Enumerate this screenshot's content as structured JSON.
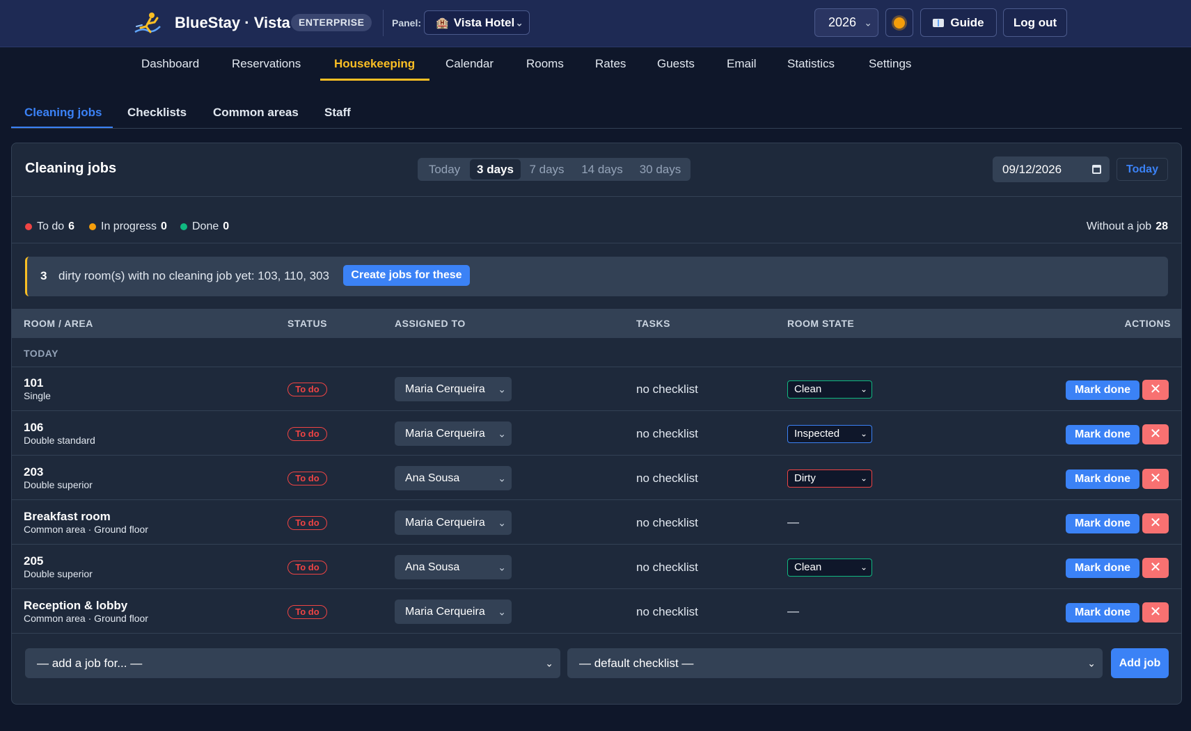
{
  "header": {
    "brand": "BlueStay · Vista",
    "badge": "ENTERPRISE",
    "panel_label": "Panel:",
    "panel_value": "Vista Hotel",
    "year": "2026",
    "guide_label": "Guide",
    "logout_label": "Log out"
  },
  "nav": {
    "items": [
      "Dashboard",
      "Reservations",
      "Housekeeping",
      "Calendar",
      "Rooms",
      "Rates",
      "Guests",
      "Email",
      "Statistics",
      "Settings"
    ],
    "active": "Housekeeping"
  },
  "subtabs": {
    "items": [
      "Cleaning jobs",
      "Checklists",
      "Common areas",
      "Staff"
    ],
    "active": "Cleaning jobs"
  },
  "card": {
    "title": "Cleaning jobs",
    "ranges": [
      "Today",
      "3 days",
      "7 days",
      "14 days",
      "30 days"
    ],
    "active_range": "3 days",
    "date": "09/12/2026",
    "today_label": "Today"
  },
  "stats": {
    "todo_label": "To do",
    "todo_count": "6",
    "inprogress_label": "In progress",
    "inprogress_count": "0",
    "done_label": "Done",
    "done_count": "0",
    "without_label": "Without a job",
    "without_count": "28",
    "colors": {
      "todo": "#ef4444",
      "inprogress": "#f59e0b",
      "done": "#10b981"
    }
  },
  "alert": {
    "count": "3",
    "text": "dirty room(s) with no cleaning job yet: 103, 110, 303",
    "button": "Create jobs for these"
  },
  "table": {
    "headers": {
      "room": "ROOM / AREA",
      "status": "STATUS",
      "assigned": "ASSIGNED TO",
      "tasks": "TASKS",
      "state": "ROOM STATE",
      "actions": "ACTIONS"
    },
    "group": "TODAY",
    "mark_label": "Mark done",
    "delete_label": "✕",
    "rows": [
      {
        "name": "101",
        "sub": "Single",
        "status": "To do",
        "assignee": "Maria Cerqueira",
        "tasks": "no checklist",
        "state": "Clean",
        "state_color": "#10b981"
      },
      {
        "name": "106",
        "sub": "Double standard",
        "status": "To do",
        "assignee": "Maria Cerqueira",
        "tasks": "no checklist",
        "state": "Inspected",
        "state_color": "#3b82f6"
      },
      {
        "name": "203",
        "sub": "Double superior",
        "status": "To do",
        "assignee": "Ana Sousa",
        "tasks": "no checklist",
        "state": "Dirty",
        "state_color": "#ef4444"
      },
      {
        "name": "Breakfast room",
        "sub": "Common area · Ground floor",
        "status": "To do",
        "assignee": "Maria Cerqueira",
        "tasks": "no checklist",
        "state": "—",
        "state_color": ""
      },
      {
        "name": "205",
        "sub": "Double superior",
        "status": "To do",
        "assignee": "Ana Sousa",
        "tasks": "no checklist",
        "state": "Clean",
        "state_color": "#10b981"
      },
      {
        "name": "Reception & lobby",
        "sub": "Common area · Ground floor",
        "status": "To do",
        "assignee": "Maria Cerqueira",
        "tasks": "no checklist",
        "state": "—",
        "state_color": ""
      }
    ]
  },
  "add": {
    "job_placeholder": "— add a job for... —",
    "checklist_placeholder": "— default checklist —",
    "button": "Add job"
  }
}
